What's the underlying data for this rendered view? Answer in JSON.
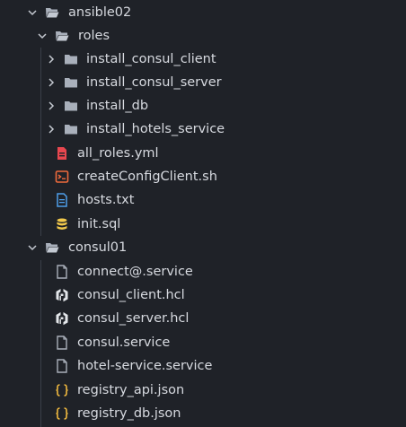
{
  "explorer": {
    "ansible02": "ansible02",
    "roles": "roles",
    "install_consul_client": "install_consul_client",
    "install_consul_server": "install_consul_server",
    "install_db": "install_db",
    "install_hotels_service": "install_hotels_service",
    "all_roles": "all_roles.yml",
    "create_config_client": "createConfigClient.sh",
    "hosts": "hosts.txt",
    "init_sql": "init.sql",
    "consul01": "consul01",
    "connect_service": "connect@.service",
    "consul_client_hcl": "consul_client.hcl",
    "consul_server_hcl": "consul_server.hcl",
    "consul_service": "consul.service",
    "hotel_service": "hotel-service.service",
    "registry_api": "registry_api.json",
    "registry_db": "registry_db.json"
  },
  "icons": {
    "folder": "folder-icon",
    "yaml": "yaml-file-icon",
    "shell": "shell-script-icon",
    "text": "text-file-icon",
    "database": "database-icon",
    "file": "file-icon",
    "hcl": "hashicorp-icon",
    "json": "json-braces-icon"
  },
  "colors": {
    "background": "#1f2228",
    "text": "#d7dae0",
    "folder": "#a9b0bb",
    "yaml": "#e8474f",
    "shell": "#ee6a3c",
    "text_file": "#4f9ee9",
    "database": "#f2c94c",
    "json": "#f0b93f"
  }
}
